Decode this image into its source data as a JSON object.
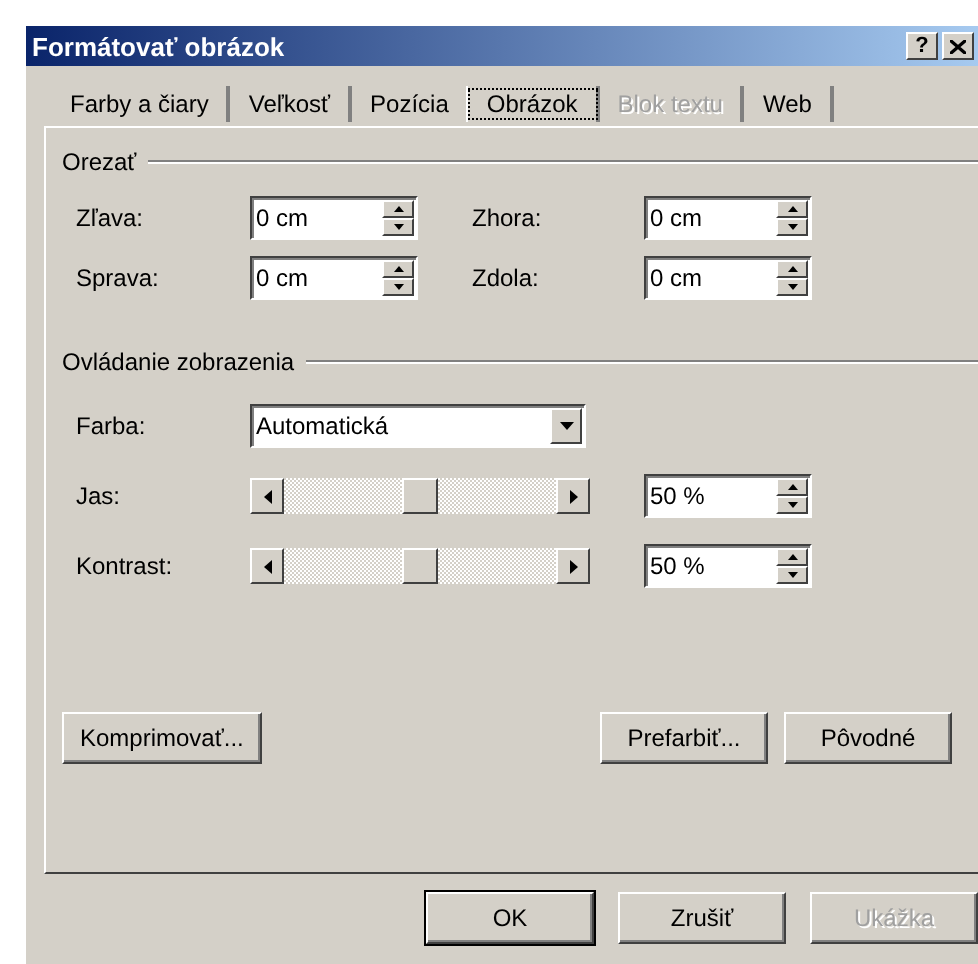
{
  "window": {
    "title": "Formátovať obrázok",
    "help": "?"
  },
  "tabs": [
    {
      "label": "Farby a čiary",
      "selected": false,
      "disabled": false
    },
    {
      "label": "Veľkosť",
      "selected": false,
      "disabled": false
    },
    {
      "label": "Pozícia",
      "selected": false,
      "disabled": false
    },
    {
      "label": "Obrázok",
      "selected": true,
      "disabled": false
    },
    {
      "label": "Blok textu",
      "selected": false,
      "disabled": true
    },
    {
      "label": "Web",
      "selected": false,
      "disabled": false
    }
  ],
  "crop": {
    "title": "Orezať",
    "fields": [
      {
        "label": "Zľava:",
        "value": "0 cm"
      },
      {
        "label": "Zhora:",
        "value": "0 cm"
      },
      {
        "label": "Sprava:",
        "value": "0 cm"
      },
      {
        "label": "Zdola:",
        "value": "0 cm"
      }
    ]
  },
  "image_control": {
    "title": "Ovládanie zobrazenia",
    "color": {
      "label": "Farba:",
      "value": "Automatická"
    },
    "sliders": [
      {
        "label": "Jas:",
        "level": 0.5,
        "value": "50 %"
      },
      {
        "label": "Kontrast:",
        "level": 0.5,
        "value": "50 %"
      }
    ]
  },
  "panel_buttons": [
    {
      "label": "Komprimovať..."
    },
    {
      "label": "Prefarbiť..."
    },
    {
      "label": "Pôvodné"
    }
  ],
  "buttons": [
    {
      "label": "OK",
      "default": true,
      "disabled": false
    },
    {
      "label": "Zrušiť",
      "default": false,
      "disabled": false
    },
    {
      "label": "Ukážka",
      "default": false,
      "disabled": true
    }
  ]
}
